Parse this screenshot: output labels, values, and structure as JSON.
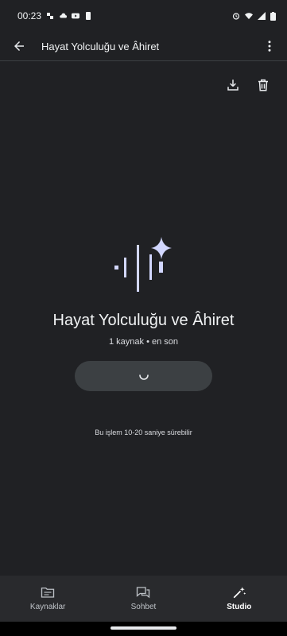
{
  "status_bar": {
    "time": "00:23"
  },
  "app_bar": {
    "title": "Hayat Yolculuğu ve Âhiret"
  },
  "main": {
    "notebook_title": "Hayat Yolculuğu ve Âhiret",
    "meta": "1 kaynak • en son",
    "processing_note": "Bu işlem 10-20 saniye sürebilir"
  },
  "bottom_nav": {
    "items": [
      {
        "label": "Kaynaklar",
        "icon": "folder-icon"
      },
      {
        "label": "Sohbet",
        "icon": "chat-icon"
      },
      {
        "label": "Studio",
        "icon": "magic-wand-icon",
        "active": true
      }
    ]
  },
  "colors": {
    "background": "#202124",
    "accent": "#d2d7ff",
    "button": "#3c4043",
    "nav": "#292a2d"
  }
}
